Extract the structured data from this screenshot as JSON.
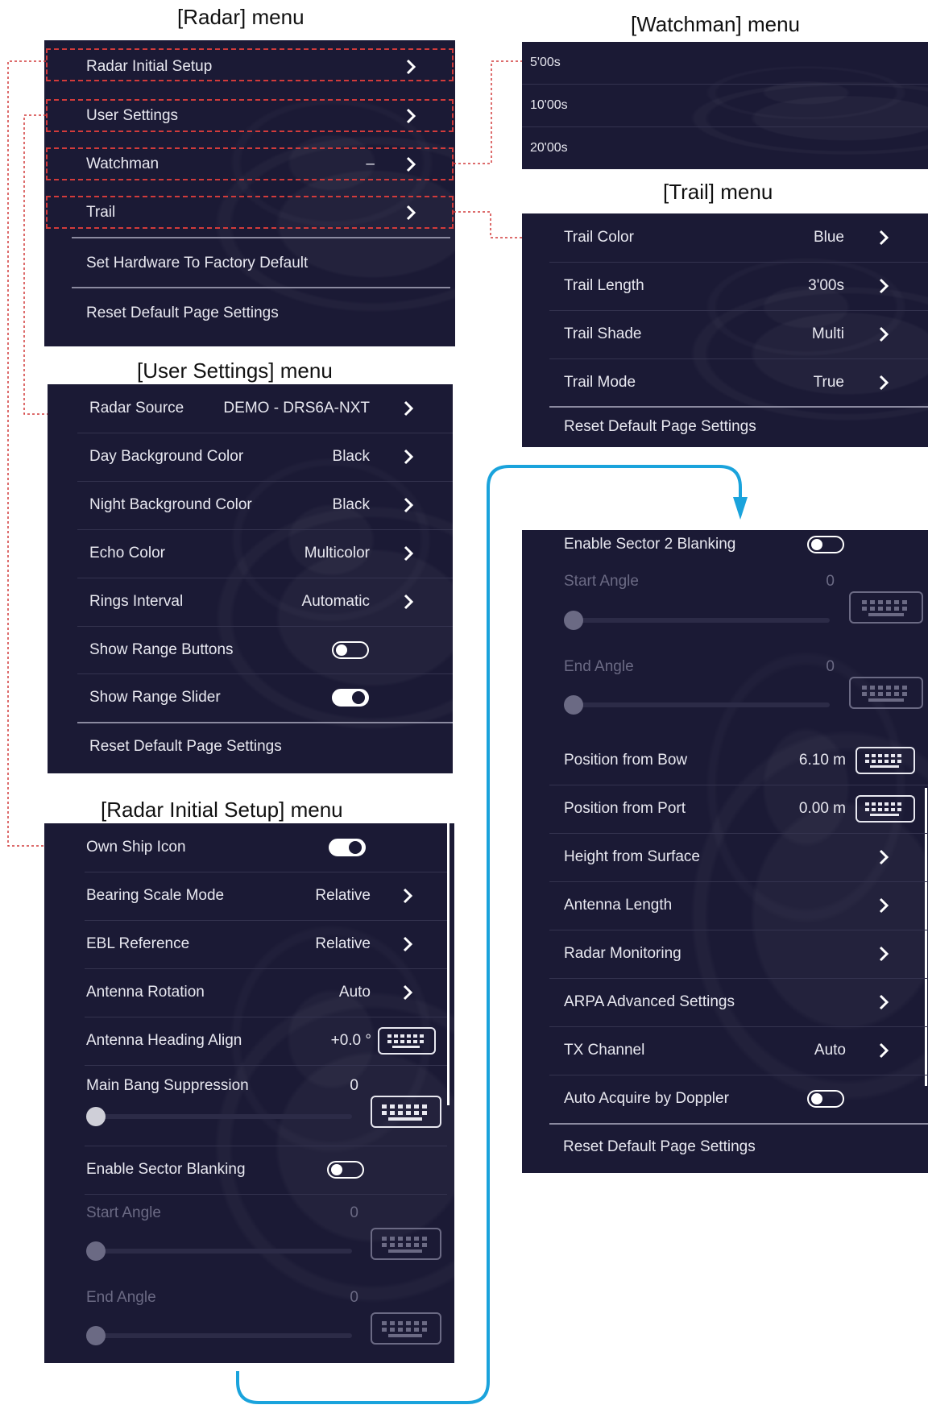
{
  "captions": {
    "radar": "[Radar] menu",
    "watchman": "[Watchman] menu",
    "trail": "[Trail] menu",
    "user_settings": "[User Settings] menu",
    "initial_setup": "[Radar Initial Setup] menu"
  },
  "radar_menu": {
    "items": [
      "Radar Initial Setup",
      "User Settings",
      "Watchman",
      "Trail",
      "Set Hardware To Factory Default",
      "Reset Default Page Settings"
    ],
    "watchman_value": "–"
  },
  "watchman_menu": {
    "options": [
      "5'00s",
      "10'00s",
      "20'00s"
    ]
  },
  "trail_menu": {
    "rows": [
      {
        "label": "Trail Color",
        "value": "Blue"
      },
      {
        "label": "Trail Length",
        "value": "3'00s"
      },
      {
        "label": "Trail Shade",
        "value": "Multi"
      },
      {
        "label": "Trail Mode",
        "value": "True"
      }
    ],
    "reset": "Reset Default Page Settings"
  },
  "user_settings_menu": {
    "rows": [
      {
        "label": "Radar Source",
        "value": "DEMO - DRS6A-NXT"
      },
      {
        "label": "Day Background Color",
        "value": "Black"
      },
      {
        "label": "Night Background Color",
        "value": "Black"
      },
      {
        "label": "Echo Color",
        "value": "Multicolor"
      },
      {
        "label": "Rings Interval",
        "value": "Automatic"
      }
    ],
    "toggles": [
      {
        "label": "Show Range Buttons",
        "on": false
      },
      {
        "label": "Show Range Slider",
        "on": true
      }
    ],
    "reset": "Reset Default Page Settings"
  },
  "initial_setup_menu": {
    "own_ship_icon": {
      "label": "Own Ship Icon",
      "on": true
    },
    "rows": [
      {
        "label": "Bearing Scale Mode",
        "value": "Relative"
      },
      {
        "label": "EBL Reference",
        "value": "Relative"
      },
      {
        "label": "Antenna Rotation",
        "value": "Auto"
      }
    ],
    "heading_align": {
      "label": "Antenna Heading Align",
      "value": "+0.0 °"
    },
    "main_bang": {
      "label": "Main Bang Suppression",
      "value": "0"
    },
    "sector_blanking": {
      "label": "Enable Sector Blanking",
      "on": false
    },
    "start_angle": {
      "label": "Start Angle",
      "value": "0"
    },
    "end_angle": {
      "label": "End Angle",
      "value": "0"
    }
  },
  "setup_continued": {
    "sector2": {
      "label": "Enable Sector 2 Blanking",
      "on": false
    },
    "start_angle": {
      "label": "Start Angle",
      "value": "0"
    },
    "end_angle": {
      "label": "End Angle",
      "value": "0"
    },
    "position_bow": {
      "label": "Position from Bow",
      "value": "6.10 m"
    },
    "position_port": {
      "label": "Position from Port",
      "value": "0.00 m"
    },
    "nav_rows": [
      "Height from Surface",
      "Antenna Length",
      "Radar Monitoring",
      "ARPA Advanced Settings"
    ],
    "tx_channel": {
      "label": "TX Channel",
      "value": "Auto"
    },
    "auto_acquire": {
      "label": "Auto Acquire by Doppler",
      "on": false
    },
    "reset": "Reset Default Page Settings"
  },
  "colors": {
    "panel_bg": "#1b1a35",
    "text": "#e8e8f0",
    "dim_text": "#6b6a84",
    "callout_red": "#d23b3b",
    "flow_arrow": "#1aa3dc"
  }
}
